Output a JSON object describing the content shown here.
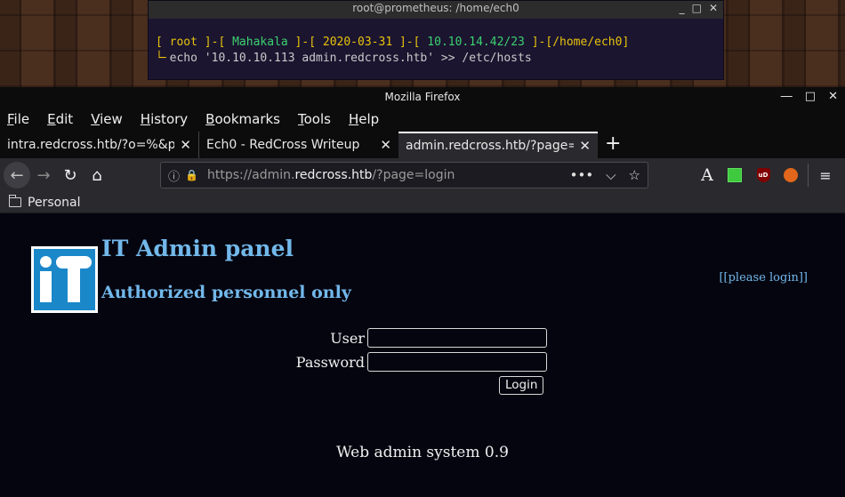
{
  "terminal": {
    "title": "root@prometheus: /home/ech0",
    "prompt": {
      "open1": "[ ",
      "user": "root",
      "mid1": " ]-[ ",
      "host": "Mahakala",
      "mid2": " ]-[ ",
      "date": "2020-03-31",
      "mid3": " ]-[ ",
      "ip": "10.10.14.42/23",
      "mid4": " ]-[",
      "path": "/home/ech0",
      "close": "]"
    },
    "arrow": "└╴",
    "command": "echo '10.10.10.113 admin.redcross.htb' >> /etc/hosts",
    "controls": [
      "_",
      "□",
      "✕"
    ]
  },
  "browser": {
    "title": "Mozilla Firefox",
    "controls": [
      "―",
      "□",
      "✕"
    ],
    "menu": [
      "File",
      "Edit",
      "View",
      "History",
      "Bookmarks",
      "Tools",
      "Help"
    ],
    "tabs": [
      {
        "label": "intra.redcross.htb/?o=%&pa",
        "close": "✕"
      },
      {
        "label": "Ech0 - RedCross Writeup",
        "close": "✕"
      },
      {
        "label": "admin.redcross.htb/?page=l",
        "close": "✕"
      }
    ],
    "new_tab": "+",
    "nav": {
      "back": "←",
      "forward": "→",
      "reload": "↻",
      "home": "⌂"
    },
    "url": {
      "prefix": "https://admin.",
      "domain": "redcross.htb",
      "suffix": "/?page=login"
    },
    "url_icons": {
      "info": "ⓘ",
      "lock": "🔒",
      "more": "•••",
      "pocket": "⌵",
      "star": "☆"
    },
    "extensions": {
      "reader": "A",
      "ublock": "uD",
      "menu": "≡"
    },
    "bookmarks": [
      {
        "label": "Personal",
        "icon": "folder-icon"
      }
    ]
  },
  "page": {
    "heading": "IT Admin panel",
    "subheading": "Authorized personnel only",
    "login_link": "[[please login]]",
    "form": {
      "user_label": "User",
      "user_value": "",
      "password_label": "Password",
      "password_value": "",
      "submit": "Login"
    },
    "footer": "Web admin system 0.9"
  },
  "colors": {
    "page_bg": "#050510",
    "heading": "#72b8ea",
    "terminal_yellow": "#e8c20c",
    "terminal_green": "#3bd16f",
    "logo_blue": "#1a87c9"
  }
}
